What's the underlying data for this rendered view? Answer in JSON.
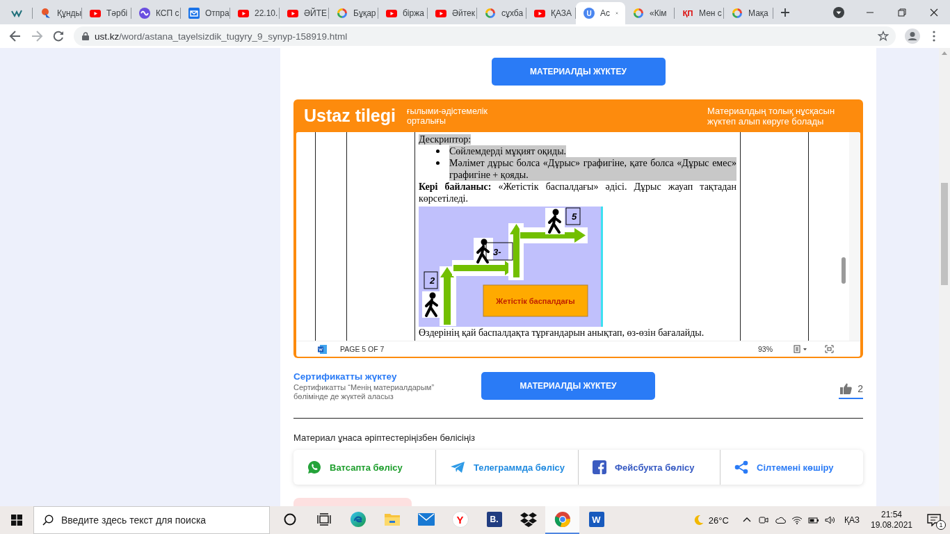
{
  "browser": {
    "tabs": [
      {
        "kind": "logo",
        "selected": false
      },
      {
        "kind": "pin",
        "title": "Құнды",
        "selected": false
      },
      {
        "kind": "video",
        "title": "Тәрбі",
        "selected": false
      },
      {
        "kind": "wave",
        "title": "КСП с",
        "selected": false
      },
      {
        "kind": "envelope",
        "title": "Отпра",
        "selected": false
      },
      {
        "kind": "video",
        "title": "22.10.",
        "selected": false
      },
      {
        "kind": "video",
        "title": "ӘЙТЕ",
        "selected": false
      },
      {
        "kind": "google",
        "title": "Бұқар",
        "selected": false
      },
      {
        "kind": "video",
        "title": "біржа",
        "selected": false
      },
      {
        "kind": "video",
        "title": "Әйтек",
        "selected": false
      },
      {
        "kind": "google",
        "title": "сұхба",
        "selected": false
      },
      {
        "kind": "video",
        "title": "ҚАЗА",
        "selected": false
      },
      {
        "kind": "letter",
        "badge": "U",
        "title": "Ас",
        "selected": true
      },
      {
        "kind": "google",
        "title": "«Кім",
        "selected": false
      },
      {
        "kind": "lettermark",
        "badge": "ҚП",
        "title": "Мен с",
        "selected": false
      },
      {
        "kind": "google",
        "title": "Мақа",
        "selected": false
      }
    ],
    "address": {
      "host": "ust.kz",
      "path": "/word/astana_tayelsizdik_tugyry_9_synyp-158919.html"
    }
  },
  "page": {
    "top_button": "МАТЕРИАЛДЫ ЖҮКТЕУ",
    "banner": {
      "logo": "Ustaz tilegi",
      "subtitle": "ғылыми-әдістемелік орталығы",
      "notice": "Материалдың толық нұсқасын жүктеп алып көруге болады"
    },
    "document": {
      "blocks": [
        {
          "kind": "paragraph",
          "text": "Дескриптор:",
          "highlighted": true
        },
        {
          "kind": "bullet",
          "text": "Сөйлемдерді мұқият оқиды.",
          "highlighted": true
        },
        {
          "kind": "bullet",
          "text": "Мәлімет дұрыс болса «Дұрыс» графигіне, қате болса «Дұрыс емес» графигіне + қояды.",
          "highlighted": true
        },
        {
          "kind": "paragraph",
          "text": "**Кері байланыс:** «Жетістік баспалдағы» әдісі. Дұрыс жауап тақтадан көрсетіледі.",
          "highlighted": false
        },
        {
          "kind": "figure",
          "labels": [
            "2",
            "3-",
            "5"
          ],
          "caption": "Жетістік баспалдағы"
        },
        {
          "kind": "paragraph",
          "text": "Өздерінің қай баспалдақта тұрғандарын анықтап, өз-өзін бағалайды.",
          "highlighted": false
        }
      ],
      "status": {
        "page": "PAGE 5 OF 7",
        "zoom": "93%"
      }
    },
    "certificate": {
      "link": "Сертификатты жүктеу",
      "note": "Сертификатты “Менің материалдарым” бөлімінде де жүктей аласыз"
    },
    "download_button": "МАТЕРИАЛДЫ ЖҮКТЕУ",
    "likes": "2",
    "share": {
      "prompt": "Материал ұнаса әріптестеріңізбен бөлісіңіз",
      "items": [
        {
          "kind": "whatsapp",
          "label": "Ватсапта бөлісу"
        },
        {
          "kind": "telegram",
          "label": "Телеграммда бөлісу"
        },
        {
          "kind": "facebook",
          "label": "Фейсбукта бөлісу"
        },
        {
          "kind": "link",
          "label": "Сілтемені көшіру"
        }
      ]
    }
  },
  "taskbar": {
    "search": {
      "placeholder": "Введите здесь текст для поиска"
    },
    "apps": [
      {
        "kind": "cortana",
        "selected": false
      },
      {
        "kind": "taskview",
        "selected": false
      },
      {
        "kind": "edge",
        "selected": false
      },
      {
        "kind": "folder",
        "selected": false
      },
      {
        "kind": "mail",
        "selected": false
      },
      {
        "kind": "yandex",
        "badge": "Y",
        "selected": false
      },
      {
        "kind": "booking",
        "badge": "B.",
        "selected": false
      },
      {
        "kind": "dropbox",
        "selected": false
      },
      {
        "kind": "chrome",
        "selected": true
      },
      {
        "kind": "word",
        "badge": "W",
        "selected": false
      }
    ],
    "weather": "26°C",
    "language": "ҚАЗ",
    "time": "21:54",
    "date": "19.08.2021",
    "notifications": "1"
  }
}
